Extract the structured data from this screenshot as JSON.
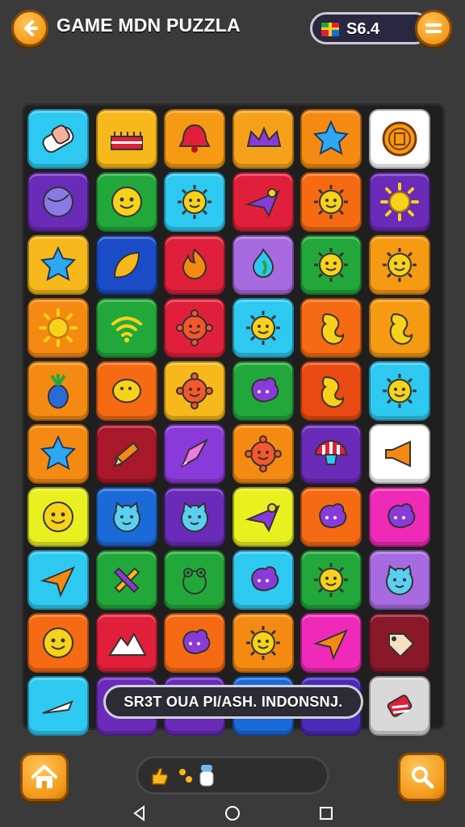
{
  "header": {
    "title": "GAME MDN PUZZLA",
    "coins": "S6.4",
    "back_icon": "arrow-left-icon",
    "menu_icon": "menu-icon",
    "coin_icon": "gift-box-icon"
  },
  "board": {
    "rows": 10,
    "cols": 6,
    "tiles": [
      [
        "#2ec9f0",
        "eraser"
      ],
      [
        "#f6b81a",
        "cake"
      ],
      [
        "#f59a12",
        "bell"
      ],
      [
        "#f5a21a",
        "crown"
      ],
      [
        "#f58a12",
        "star"
      ],
      [
        "#ffffff",
        "coin"
      ],
      [
        "#6a2bb8",
        "ball"
      ],
      [
        "#22a83a",
        "smile"
      ],
      [
        "#2ec9f0",
        "sun-face"
      ],
      [
        "#e0203a",
        "plane"
      ],
      [
        "#f56a12",
        "sun-face"
      ],
      [
        "#6a2bb8",
        "sun"
      ],
      [
        "#f6b81a",
        "star"
      ],
      [
        "#1a4cc8",
        "leaf"
      ],
      [
        "#e0203a",
        "fire"
      ],
      [
        "#a86ae0",
        "flame"
      ],
      [
        "#22a83a",
        "sun-face"
      ],
      [
        "#f59a12",
        "sun-face"
      ],
      [
        "#f58a12",
        "sun"
      ],
      [
        "#22a83a",
        "wifi"
      ],
      [
        "#e0203a",
        "gear-face"
      ],
      [
        "#2ec9f0",
        "sun-face"
      ],
      [
        "#f56a12",
        "swirl"
      ],
      [
        "#f59a12",
        "swirl"
      ],
      [
        "#f58a12",
        "pineapple"
      ],
      [
        "#f56a12",
        "lemon"
      ],
      [
        "#f6b81a",
        "gear-face"
      ],
      [
        "#22a83a",
        "blob"
      ],
      [
        "#e84a12",
        "swirl"
      ],
      [
        "#2ec9f0",
        "sun-face"
      ],
      [
        "#f58a12",
        "star"
      ],
      [
        "#a8182a",
        "pencil"
      ],
      [
        "#8a3ad8",
        "rocket"
      ],
      [
        "#f58a12",
        "gear-face"
      ],
      [
        "#6a2bb8",
        "mushroom"
      ],
      [
        "#ffffff",
        "megaphone"
      ],
      [
        "#e8f020",
        "smile"
      ],
      [
        "#1a6ad8",
        "cat"
      ],
      [
        "#6a2bb8",
        "cat"
      ],
      [
        "#e8f020",
        "plane"
      ],
      [
        "#f56a12",
        "blob"
      ],
      [
        "#f02ab8",
        "blob"
      ],
      [
        "#2ec9f0",
        "paper-plane"
      ],
      [
        "#22a83a",
        "tools"
      ],
      [
        "#22a83a",
        "frog"
      ],
      [
        "#2ec9f0",
        "blob"
      ],
      [
        "#22a83a",
        "sun-face"
      ],
      [
        "#a86ae0",
        "cat"
      ],
      [
        "#f56a12",
        "smile"
      ],
      [
        "#e0203a",
        "mountain"
      ],
      [
        "#f56a12",
        "blob"
      ],
      [
        "#f58a12",
        "sun-face"
      ],
      [
        "#f02ab8",
        "paper-plane"
      ],
      [
        "#8a1828",
        "tag"
      ],
      [
        "#2ec9f0",
        "knife"
      ],
      [
        "#6a2bb8",
        "empty"
      ],
      [
        "#6a2bb8",
        "empty"
      ],
      [
        "#1a6ad8",
        "empty"
      ],
      [
        "#4a2bb8",
        "empty"
      ],
      [
        "#d8d8d8",
        "candy"
      ]
    ]
  },
  "banner": {
    "text": "SR3T OUA PI/ASH. INDONSNJ."
  },
  "bottom": {
    "home_icon": "home-icon",
    "search_icon": "search-icon",
    "powerups": [
      "thumb-up-icon",
      "dots-icon",
      "potion-icon"
    ]
  },
  "navbar": {
    "back": "nav-back-icon",
    "home": "nav-home-icon",
    "recents": "nav-recents-icon"
  }
}
